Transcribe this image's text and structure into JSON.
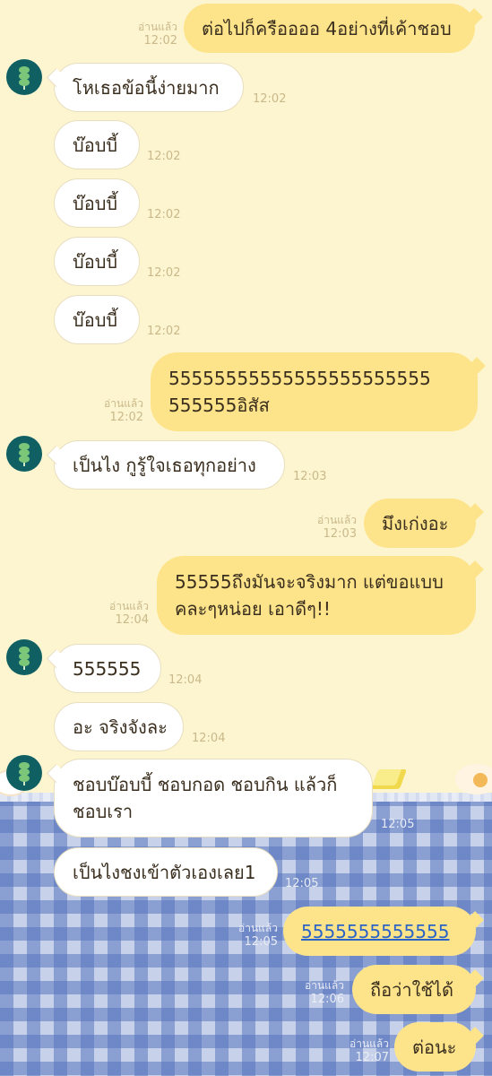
{
  "chat": {
    "read_label": "อ่านแล้ว",
    "messages": [
      {
        "dir": "out",
        "text": "ต่อไปก็ครืออออ 4อย่างที่เค้าชอบ",
        "time": "12:02",
        "read": true
      },
      {
        "dir": "in",
        "avatar": true,
        "text": "โหเธอข้อนี้ง่ายมาก",
        "time": "12:02"
      },
      {
        "dir": "in",
        "text": "บ๊อบบี้",
        "time": "12:02"
      },
      {
        "dir": "in",
        "text": "บ๊อบบี้",
        "time": "12:02"
      },
      {
        "dir": "in",
        "text": "บ๊อบบี้",
        "time": "12:02"
      },
      {
        "dir": "in",
        "text": "บ๊อบบี้",
        "time": "12:02"
      },
      {
        "dir": "out",
        "lines": [
          "55555555555555555555555",
          "555555อิสัส"
        ],
        "time": "12:02",
        "read": true
      },
      {
        "dir": "in",
        "avatar": true,
        "text": "เป็นไง กูรู้ใจเธอทุกอย่าง",
        "time": "12:03"
      },
      {
        "dir": "out",
        "text": "มึงเก่งอะ",
        "time": "12:03",
        "read": true
      },
      {
        "dir": "out",
        "lines": [
          "55555ถึงมันจะจริงมาก แต่ขอแบบ",
          "คละๆหน่อย เอาดีๆ!!"
        ],
        "time": "12:04",
        "read": true
      },
      {
        "dir": "in",
        "avatar": true,
        "text": "555555",
        "time": "12:04"
      },
      {
        "dir": "in",
        "text": "อะ จริงจังละ",
        "time": "12:04"
      },
      {
        "dir": "in",
        "avatar": true,
        "lines": [
          "ชอบบ๊อบบี้ ชอบกอด ชอบกิน แล้วก็",
          "ชอบเรา"
        ],
        "time": "12:05"
      },
      {
        "dir": "in",
        "text": "เป็นไงชงเข้าตัวเองเลย1",
        "time": "12:05"
      },
      {
        "dir": "out",
        "text": "5555555555555",
        "link": true,
        "time": "12:05",
        "read": true
      },
      {
        "dir": "out",
        "text": "ถือว่าใช้ได้",
        "time": "12:06",
        "read": true
      },
      {
        "dir": "out",
        "text": "ต่อนะ",
        "time": "12:07",
        "read": true
      }
    ]
  },
  "colors": {
    "background": "#fdf5cf",
    "bubble_in": "#ffffff",
    "bubble_out": "#fde48a",
    "avatar": "#0f5f63",
    "link": "#2b63c7"
  },
  "icons": {
    "avatar": "green-dango-icon"
  }
}
